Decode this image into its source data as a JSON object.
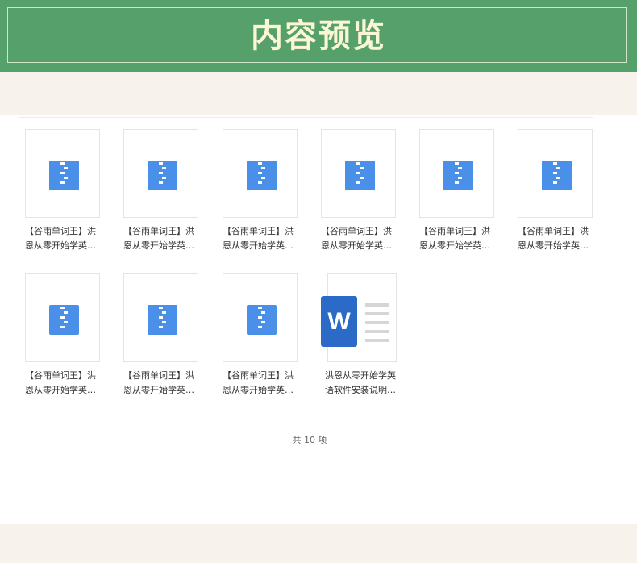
{
  "header": {
    "title": "内容预览"
  },
  "files": [
    {
      "line1": "【谷雨单词王】洪",
      "line2": "恩从零开始学英…",
      "icon": "zip-icon"
    },
    {
      "line1": "【谷雨单词王】洪",
      "line2": "恩从零开始学英…",
      "icon": "zip-icon"
    },
    {
      "line1": "【谷雨单词王】洪",
      "line2": "恩从零开始学英…",
      "icon": "zip-icon"
    },
    {
      "line1": "【谷雨单词王】洪",
      "line2": "恩从零开始学英…",
      "icon": "zip-icon"
    },
    {
      "line1": "【谷雨单词王】洪",
      "line2": "恩从零开始学英…",
      "icon": "zip-icon"
    },
    {
      "line1": "【谷雨单词王】洪",
      "line2": "恩从零开始学英…",
      "icon": "zip-icon"
    },
    {
      "line1": "【谷雨单词王】洪",
      "line2": "恩从零开始学英…",
      "icon": "zip-icon"
    },
    {
      "line1": "【谷雨单词王】洪",
      "line2": "恩从零开始学英…",
      "icon": "zip-icon"
    },
    {
      "line1": "【谷雨单词王】洪",
      "line2": "恩从零开始学英…",
      "icon": "zip-icon"
    }
  ],
  "word_file": {
    "line1": "洪恩从零开始学英",
    "line2": "语软件安装说明…",
    "icon": "word-icon",
    "logo_letter": "W"
  },
  "footer": {
    "count": "共 10 项"
  },
  "colors": {
    "header_bg": "#56a06c",
    "title": "#fbf6d3",
    "band": "#f7f3ec",
    "zip_blue": "#4a90e8",
    "word_blue": "#2b6ac6"
  }
}
